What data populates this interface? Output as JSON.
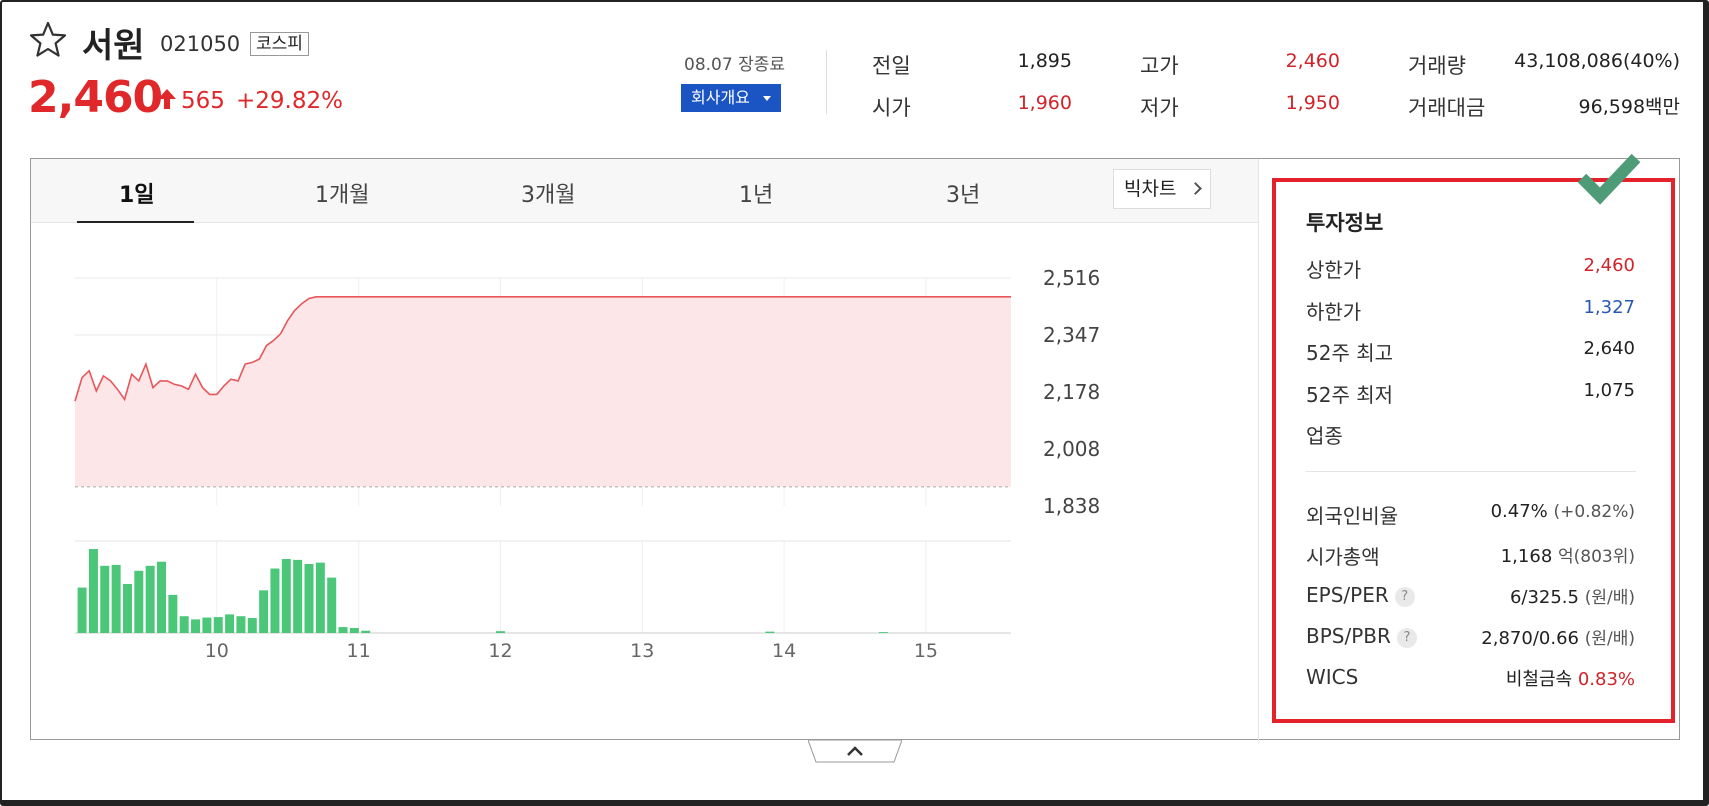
{
  "header": {
    "stock_name": "서원",
    "stock_code": "021050",
    "market": "코스피",
    "price": "2,460",
    "change": "565",
    "change_pct": "+29.82%",
    "date_status": "08.07 장종료",
    "company_button": "회사개요",
    "icons": {
      "favorite": "star-outline-icon",
      "direction": "arrow-up-icon"
    }
  },
  "quote": {
    "prev_close_label": "전일",
    "prev_close": "1,895",
    "open_label": "시가",
    "open": "1,960",
    "high_label": "고가",
    "high": "2,460",
    "low_label": "저가",
    "low": "1,950",
    "volume_label": "거래량",
    "volume": "43,108,086(40%)",
    "amount_label": "거래대금",
    "amount": "96,598백만"
  },
  "tabs": [
    {
      "label": "1일",
      "active": true
    },
    {
      "label": "1개월",
      "active": false
    },
    {
      "label": "3개월",
      "active": false
    },
    {
      "label": "1년",
      "active": false
    },
    {
      "label": "3년",
      "active": false
    }
  ],
  "big_chart_button": "빅차트",
  "chart_data": {
    "type": "line",
    "y_ticks": [
      "2,516",
      "2,347",
      "2,178",
      "2,008",
      "1,838"
    ],
    "ylim": [
      1838,
      2516
    ],
    "x_ticks": [
      "10",
      "11",
      "12",
      "13",
      "14",
      "15"
    ],
    "xlim": [
      9.0,
      15.6
    ],
    "baseline": 1895,
    "grid": true,
    "series": [
      {
        "x": [
          9.0,
          9.05,
          9.1,
          9.15,
          9.2,
          9.25,
          9.3,
          9.35,
          9.4,
          9.45,
          9.5,
          9.55,
          9.6,
          9.65,
          9.7,
          9.75,
          9.8,
          9.85,
          9.9,
          9.95,
          10.0,
          10.05,
          10.1,
          10.15,
          10.2,
          10.25,
          10.3,
          10.35,
          10.4,
          10.45,
          10.5,
          10.55,
          10.6,
          10.65,
          10.7,
          10.75,
          15.6
        ],
        "y": [
          2150,
          2220,
          2240,
          2180,
          2225,
          2210,
          2185,
          2155,
          2230,
          2210,
          2260,
          2190,
          2210,
          2210,
          2200,
          2195,
          2185,
          2230,
          2190,
          2170,
          2170,
          2195,
          2215,
          2210,
          2260,
          2265,
          2275,
          2315,
          2330,
          2350,
          2390,
          2420,
          2440,
          2455,
          2460,
          2460,
          2460
        ],
        "color": "#e8565b",
        "fill": "#fde6e7"
      }
    ],
    "volume": {
      "x": [
        9.05,
        9.13,
        9.21,
        9.29,
        9.37,
        9.45,
        9.53,
        9.61,
        9.69,
        9.77,
        9.85,
        9.93,
        10.01,
        10.09,
        10.17,
        10.25,
        10.33,
        10.41,
        10.49,
        10.57,
        10.65,
        10.73,
        10.81,
        10.89,
        10.97,
        11.05,
        12.0,
        13.9,
        14.7
      ],
      "values": [
        100,
        185,
        148,
        150,
        108,
        137,
        148,
        157,
        84,
        37,
        30,
        34,
        35,
        41,
        37,
        33,
        94,
        142,
        163,
        161,
        152,
        155,
        122,
        13,
        11,
        5,
        4,
        3,
        2
      ]
    }
  },
  "invest": {
    "title": "투자정보",
    "upper_limit_label": "상한가",
    "upper_limit": "2,460",
    "lower_limit_label": "하한가",
    "lower_limit": "1,327",
    "high52_label": "52주 최고",
    "high52": "2,640",
    "low52_label": "52주 최저",
    "low52": "1,075",
    "sector_label": "업종",
    "foreign_label": "외국인비율",
    "foreign": "0.47%",
    "foreign_change": "(+0.82%)",
    "mcap_label": "시가총액",
    "mcap": "1,168",
    "mcap_unit": "억",
    "mcap_rank": "(803위)",
    "eps_label": "EPS/PER",
    "eps": "6/325.5",
    "eps_unit": "(원/배)",
    "bps_label": "BPS/PBR",
    "bps": "2,870/0.66",
    "bps_unit": "(원/배)",
    "wics_label": "WICS",
    "wics": "비철금속",
    "wics_pct": "0.83%",
    "help_mark": "?",
    "icons": {
      "annotation": "checkmark-icon",
      "help": "question-icon"
    }
  }
}
